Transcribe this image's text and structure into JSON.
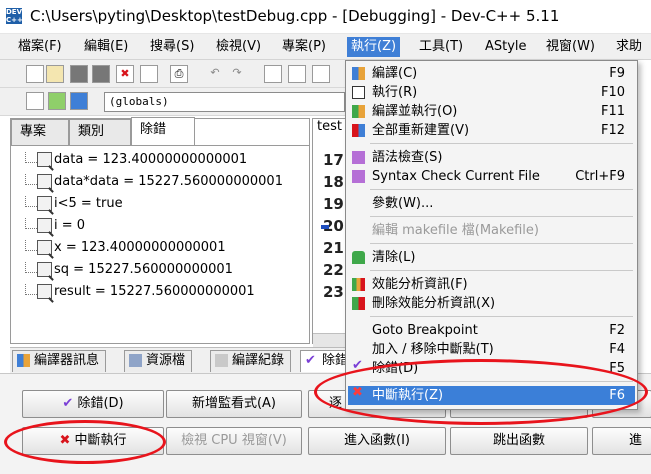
{
  "window": {
    "title": "C:\\Users\\pyting\\Desktop\\testDebug.cpp - [Debugging] - Dev-C++ 5.11",
    "app_icon_text": "DEV C++"
  },
  "menubar": {
    "items": [
      "檔案(F)",
      "編輯(E)",
      "搜尋(S)",
      "檢視(V)",
      "專案(P)",
      "執行(Z)",
      "工具(T)",
      "AStyle",
      "視窗(W)",
      "求助"
    ]
  },
  "toolbar": {
    "globals_combo": "(globals)"
  },
  "left_panel": {
    "tabs": [
      "專案",
      "類別",
      "除錯"
    ],
    "watches": [
      "data = 123.40000000000001",
      "data*data = 15227.560000000001",
      "i<5 = true",
      "i = 0",
      "x = 123.40000000000001",
      "sq = 15227.560000000001",
      "result = 15227.560000000001"
    ]
  },
  "editor": {
    "tab_label": "test",
    "line_numbers": [
      "17",
      "18",
      "19",
      "20",
      "21",
      "22",
      "23"
    ]
  },
  "bottom_tabs": [
    "編譯器訊息",
    "資源檔",
    "編譯紀錄",
    "除錯"
  ],
  "bottom_panel": {
    "row1": [
      "除錯(D)",
      "新增監看式(A)",
      "逐",
      "",
      ""
    ],
    "row2": [
      "中斷執行",
      "檢視 CPU 視窗(V)",
      "進入函數(I)",
      "跳出函數",
      "進"
    ]
  },
  "run_menu": {
    "items": [
      {
        "label": "編譯(C)",
        "shortcut": "F9"
      },
      {
        "label": "執行(R)",
        "shortcut": "F10"
      },
      {
        "label": "編譯並執行(O)",
        "shortcut": "F11"
      },
      {
        "label": "全部重新建置(V)",
        "shortcut": "F12"
      },
      {
        "label": "語法檢查(S)",
        "shortcut": ""
      },
      {
        "label": "Syntax Check Current File",
        "shortcut": "Ctrl+F9"
      },
      {
        "label": "參數(W)...",
        "shortcut": ""
      },
      {
        "label": "編輯 makefile 檔(Makefile)",
        "shortcut": ""
      },
      {
        "label": "清除(L)",
        "shortcut": ""
      },
      {
        "label": "效能分析資訊(F)",
        "shortcut": ""
      },
      {
        "label": "刪除效能分析資訊(X)",
        "shortcut": ""
      },
      {
        "label": "Goto Breakpoint",
        "shortcut": "F2"
      },
      {
        "label": "加入 / 移除中斷點(T)",
        "shortcut": "F4"
      },
      {
        "label": "除錯(D)",
        "shortcut": "F5"
      },
      {
        "label": "中斷執行(Z)",
        "shortcut": "F6"
      }
    ]
  },
  "colors": {
    "menu_highlight": "#3b7fd8",
    "annotation_red": "#e8141c",
    "stop_icon_red": "#d8141c"
  }
}
